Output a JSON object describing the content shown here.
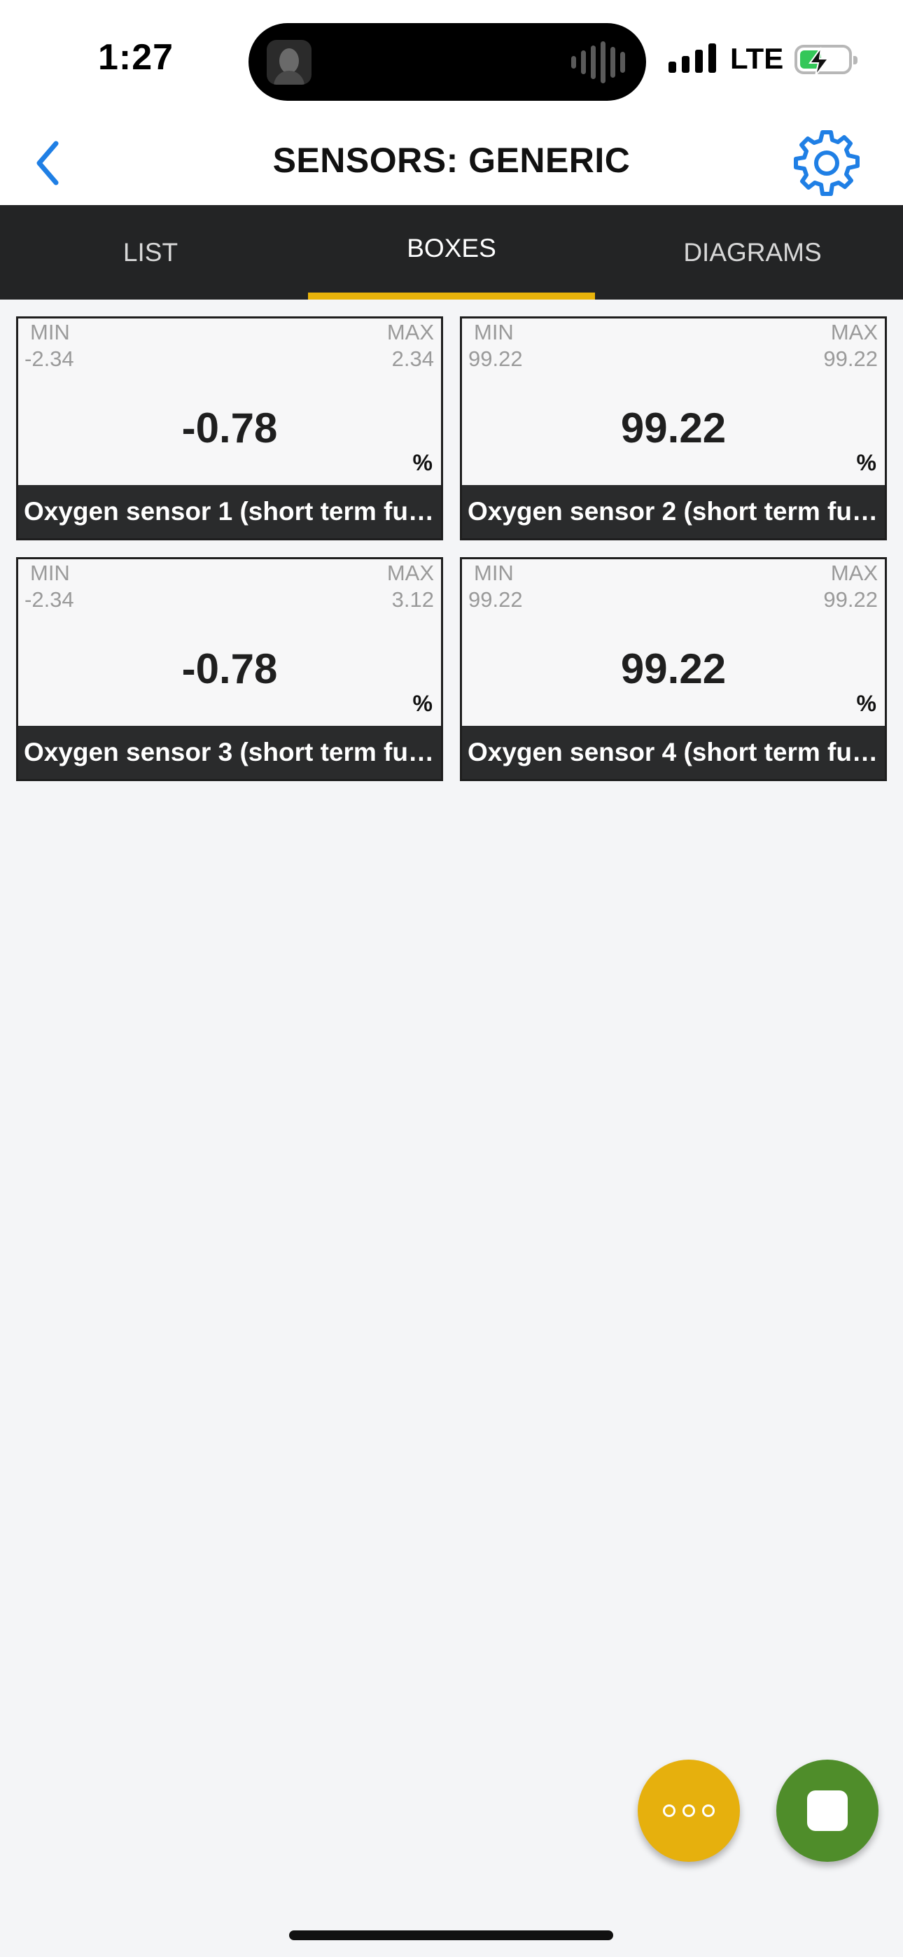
{
  "status_bar": {
    "time": "1:27",
    "network": "LTE",
    "signal_bars": 4,
    "battery_charging": true
  },
  "nav": {
    "title": "SENSORS: GENERIC",
    "back_icon": "chevron-left-icon",
    "settings_icon": "gear-icon"
  },
  "tabs": [
    {
      "label": "LIST",
      "active": false
    },
    {
      "label": "BOXES",
      "active": true
    },
    {
      "label": "DIAGRAMS",
      "active": false
    }
  ],
  "boxes": [
    {
      "min_label": "MIN",
      "min": "-2.34",
      "max_label": "MAX",
      "max": "2.34",
      "value": "-0.78",
      "unit": "%",
      "name": "Oxygen sensor 1 (short term fu…"
    },
    {
      "min_label": "MIN",
      "min": "99.22",
      "max_label": "MAX",
      "max": "99.22",
      "value": "99.22",
      "unit": "%",
      "name": "Oxygen sensor 2 (short term fu…"
    },
    {
      "min_label": "MIN",
      "min": "-2.34",
      "max_label": "MAX",
      "max": "3.12",
      "value": "-0.78",
      "unit": "%",
      "name": "Oxygen sensor 3 (short term fu…"
    },
    {
      "min_label": "MIN",
      "min": "99.22",
      "max_label": "MAX",
      "max": "99.22",
      "value": "99.22",
      "unit": "%",
      "name": "Oxygen sensor 4 (short term fu…"
    }
  ],
  "fabs": {
    "more_icon": "more-dots-icon",
    "stop_icon": "stop-icon"
  },
  "colors": {
    "accent": "#e8b30a",
    "tab_bar": "#232425",
    "stop_button": "#4f8d2a",
    "link_blue": "#1f7fe5"
  }
}
